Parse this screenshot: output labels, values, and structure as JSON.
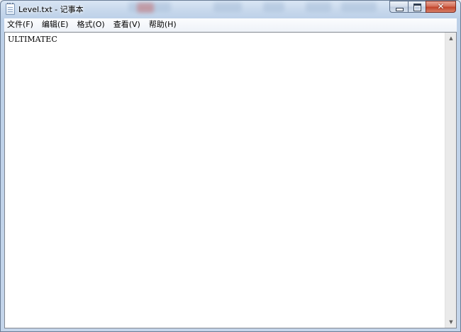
{
  "window": {
    "title": "Level.txt - 记事本",
    "app_icon": "notepad-icon",
    "controls": {
      "minimize_icon": "minimize-icon",
      "maximize_icon": "maximize-icon",
      "close_icon": "close-icon",
      "close_glyph": "✕"
    }
  },
  "menubar": {
    "items": [
      {
        "label": "文件(F)"
      },
      {
        "label": "编辑(E)"
      },
      {
        "label": "格式(O)"
      },
      {
        "label": "查看(V)"
      },
      {
        "label": "帮助(H)"
      }
    ]
  },
  "editor": {
    "content": "ULTIMATEC"
  },
  "scrollbar": {
    "up_glyph": "▲",
    "down_glyph": "▼"
  },
  "colors": {
    "close_button": "#c2452b",
    "frame": "#c4d5ea"
  }
}
